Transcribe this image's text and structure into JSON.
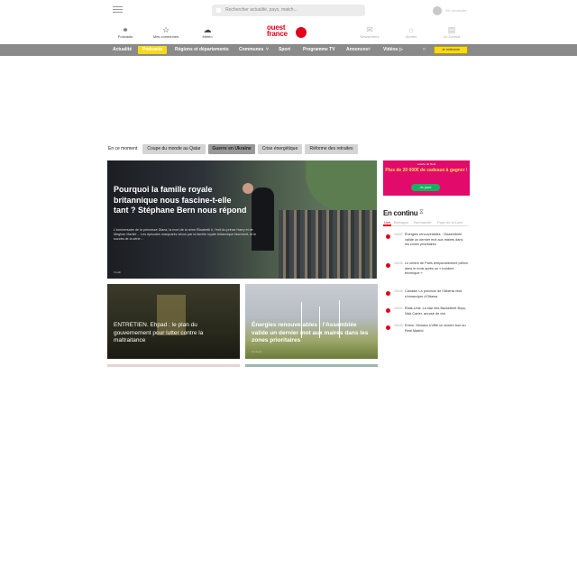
{
  "header": {
    "search_placeholder": "Rechercher actualité, pays, match...",
    "account_label": "Se connecter",
    "left_items": [
      {
        "icon": "headphones-icon",
        "label": "Podcasts"
      },
      {
        "icon": "star-icon",
        "label": "Mes communes"
      },
      {
        "icon": "cloud-sun-icon",
        "label": "Météo"
      }
    ],
    "right_items": [
      {
        "icon": "mail-icon",
        "label": "Newsletters"
      },
      {
        "icon": "bell-icon",
        "label": "Alertes"
      },
      {
        "icon": "newspaper-icon",
        "label": "Le Journal"
      }
    ],
    "logo": {
      "line1": "ouest",
      "line2": "france"
    }
  },
  "nav": {
    "items": [
      "Actualité",
      "Podcasts",
      "Régions et départements",
      "Communes",
      "Sport",
      "Programme TV",
      "Annonces",
      "Vidéos"
    ],
    "subscribe": "Je m'abonne"
  },
  "trending": {
    "label": "En ce moment",
    "pills": [
      "Coupe du monde au Qatar",
      "Guerre en Ukraine",
      "Crise énergétique",
      "Réforme des retraites"
    ]
  },
  "hero": {
    "title": "Pourquoi la famille royale britannique nous fascine-t-elle tant ? Stéphane Bern nous répond",
    "summary": "L'anniversaire de la princesse Diana, la mort de la reine Élisabeth II, l'exil du prince Harry et de Meghan Markle… Les épisodes marquants vécus par la famille royale britannique fascinent, et le succès de la série…",
    "credit": "Crédit"
  },
  "cards": [
    {
      "title": "ENTRETIEN. Ehpad : le plan du gouvernement pour lutter contre la maltraitance",
      "credit": ""
    },
    {
      "title": "Énergies renouvelables : l'Assemblée valide un dernier mot aux maires dans les zones prioritaires",
      "credit": "Contenu"
    }
  ],
  "ad": {
    "line1": "Loterie de Noël",
    "line2": "Plus de 20 000€ de cadeaux à gagner !",
    "button": "Je joue"
  },
  "en_continu": {
    "title": "En continu",
    "tabs": [
      "Une",
      "Bretagne",
      "Normandie",
      "Pays de la Loire"
    ],
    "items": [
      {
        "time": "16h52",
        "text": "Énergies renouvelables : l'Assemblée valide un dernier mot aux maires dans les zones prioritaires"
      },
      {
        "time": "16h48",
        "text": "Le centre de Paris temporairement piéton dans le mois après un « incident technique »"
      },
      {
        "time": "16h45",
        "text": "Canada. La province de l'Alberta veut s'émanciper d'Ottawa"
      },
      {
        "time": "16h41",
        "text": "États-Unis. La star des Backstreet Boys, Nick Carter, accusé de viol"
      },
      {
        "time": "16h38",
        "text": "Erreur. Monaco s'offre un ancien tour au Real Madrid"
      }
    ]
  }
}
